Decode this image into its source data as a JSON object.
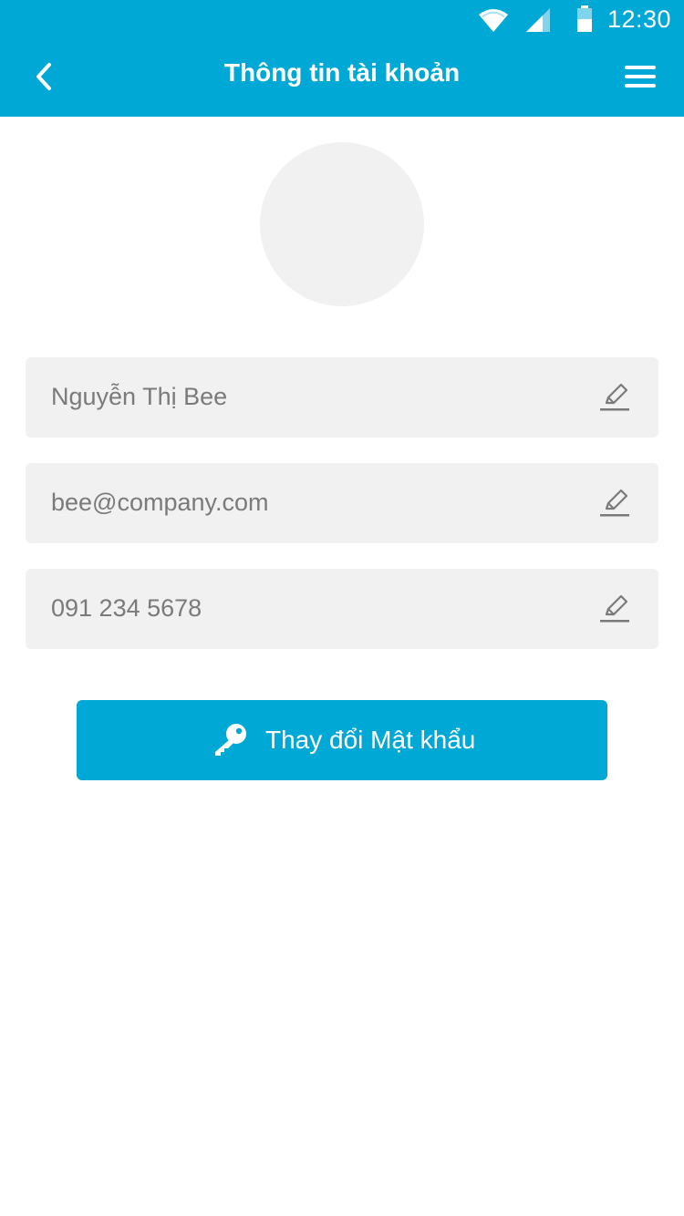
{
  "status_bar": {
    "time": "12:30",
    "icons": [
      "wifi-icon",
      "signal-icon",
      "battery-icon"
    ]
  },
  "toolbar": {
    "title": "Thông tin tài khoản",
    "back_icon": "chevron-left-icon",
    "menu_icon": "hamburger-menu-icon"
  },
  "profile": {
    "avatar_icon": "avatar"
  },
  "fields": {
    "name": "Nguyễn Thị Bee",
    "email": "bee@company.com",
    "phone": "091 234 5678",
    "edit_icon": "pencil-icon"
  },
  "actions": {
    "change_password_label": "Thay đổi Mật khẩu",
    "change_password_icon": "key-icon"
  },
  "colors": {
    "primary": "#00a8d6",
    "field_background": "#f1f1f1",
    "field_text": "#7a7a7a",
    "on_primary": "#ffffff"
  }
}
